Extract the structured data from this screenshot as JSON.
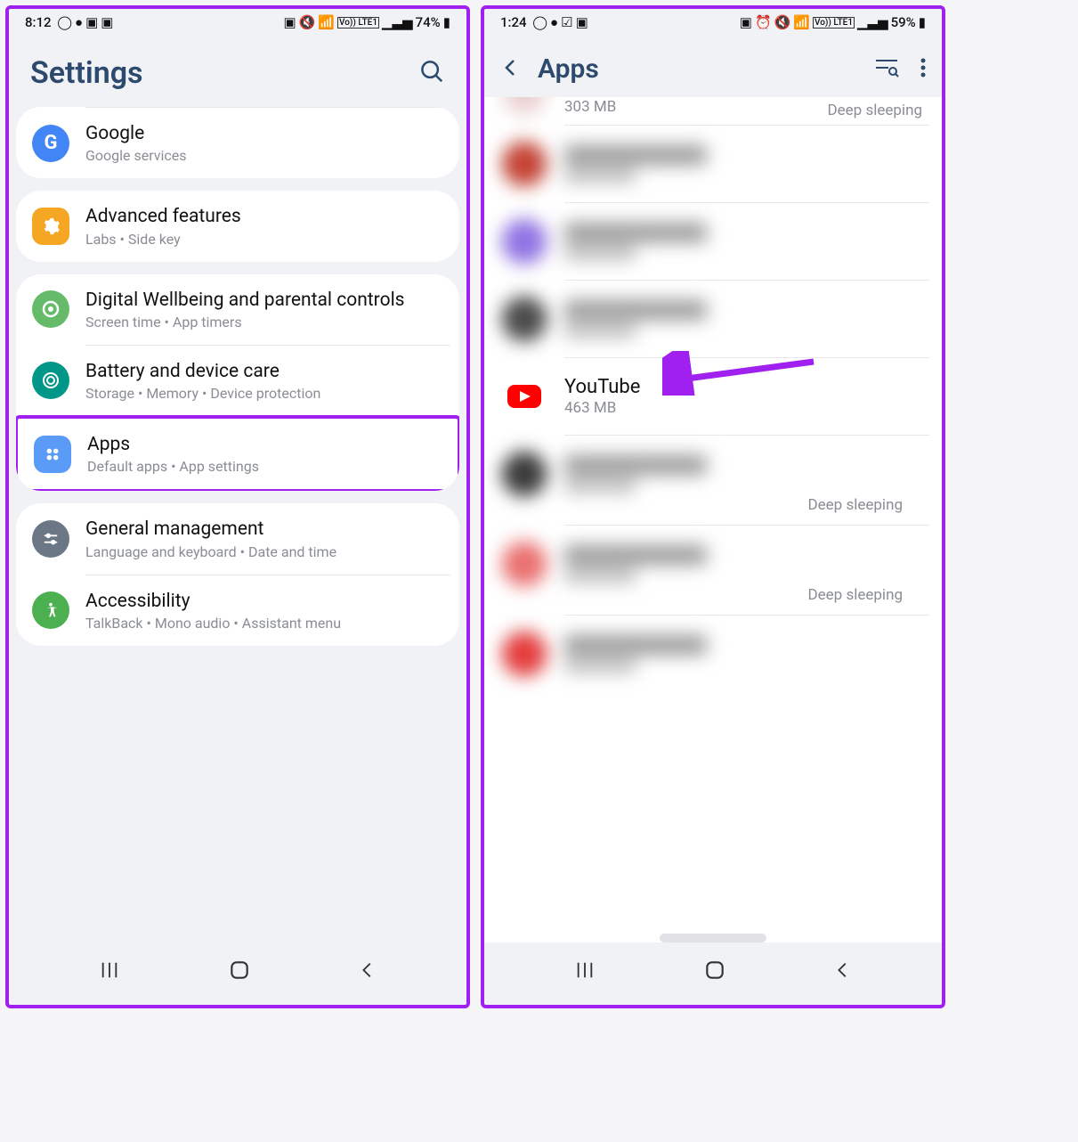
{
  "left": {
    "status": {
      "time": "8:12",
      "battery": "74%"
    },
    "title": "Settings",
    "groups": [
      {
        "items": [
          {
            "icon": "google",
            "title": "Google",
            "sub": "Google services",
            "color": "#4285f4"
          }
        ]
      },
      {
        "items": [
          {
            "icon": "advanced",
            "title": "Advanced features",
            "sub": "Labs  •  Side key",
            "color": "#f5a623"
          }
        ]
      },
      {
        "items": [
          {
            "icon": "wellbeing",
            "title": "Digital Wellbeing and parental controls",
            "sub": "Screen time  •  App timers",
            "color": "#4caf50"
          },
          {
            "icon": "battery",
            "title": "Battery and device care",
            "sub": "Storage  •  Memory  •  Device protection",
            "color": "#009688"
          },
          {
            "icon": "apps",
            "title": "Apps",
            "sub": "Default apps  •  App settings",
            "color": "#5b9bf8",
            "highlight": true
          }
        ]
      },
      {
        "items": [
          {
            "icon": "general",
            "title": "General management",
            "sub": "Language and keyboard  •  Date and time",
            "color": "#6b7785"
          },
          {
            "icon": "accessibility",
            "title": "Accessibility",
            "sub": "TalkBack  •  Mono audio  •  Assistant menu",
            "color": "#4caf50"
          }
        ]
      }
    ]
  },
  "right": {
    "status": {
      "time": "1:24",
      "battery": "59%"
    },
    "title": "Apps",
    "partial_size": "303 MB",
    "sleep_label": "Deep sleeping",
    "apps": [
      {
        "blurred": true,
        "color": "#d04a3c"
      },
      {
        "blurred": true,
        "color": "#8a6de8"
      },
      {
        "blurred": true,
        "color": "#4a4a4a"
      },
      {
        "blurred": false,
        "name": "YouTube",
        "size": "463 MB",
        "color": "#ff0000",
        "youtube": true,
        "arrow": true
      },
      {
        "blurred": true,
        "color": "#3a3a3a",
        "status": "Deep sleeping"
      },
      {
        "blurred": true,
        "color": "#e85a5a",
        "status": "Deep sleeping"
      },
      {
        "blurred": true,
        "color": "#e83a3a"
      }
    ]
  }
}
